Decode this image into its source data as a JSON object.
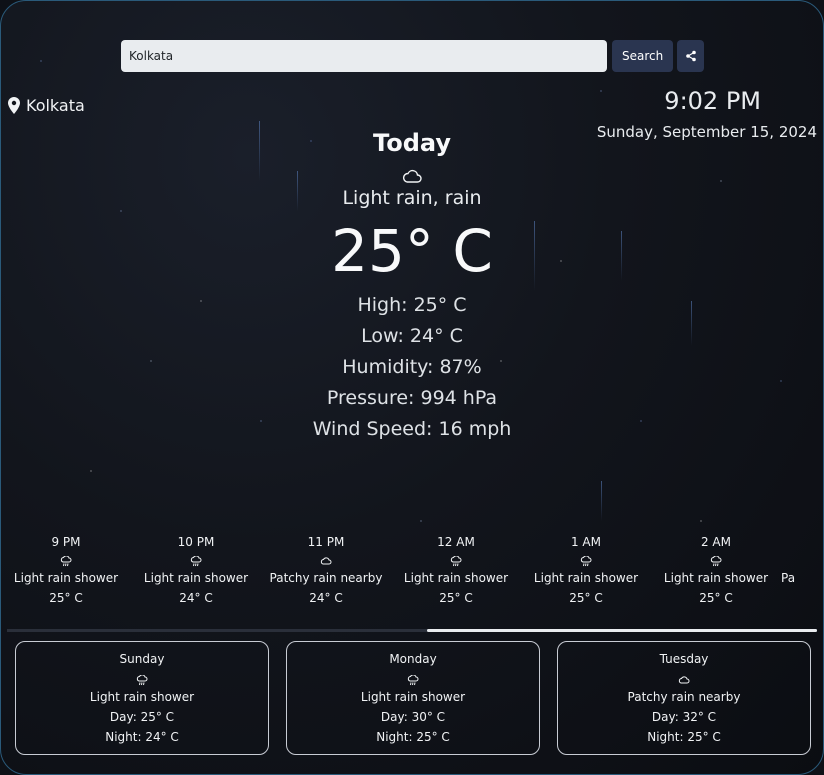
{
  "search": {
    "value": "Kolkata",
    "button_label": "Search"
  },
  "location": {
    "name": "Kolkata"
  },
  "clock": {
    "time": "9:02 PM",
    "date": "Sunday, September 15, 2024"
  },
  "current": {
    "day": "Today",
    "icon": "cloud-icon",
    "condition": "Light rain, rain",
    "temperature": "25° C",
    "high": "High: 25° C",
    "low": "Low: 24° C",
    "humidity": "Humidity: 87%",
    "pressure": "Pressure: 994 hPa",
    "wind": "Wind Speed: 16 mph"
  },
  "hourly": [
    {
      "time": "9 PM",
      "icon": "rain-cloud-icon",
      "condition": "Light rain shower",
      "temp": "25° C"
    },
    {
      "time": "10 PM",
      "icon": "rain-cloud-icon",
      "condition": "Light rain shower",
      "temp": "24° C"
    },
    {
      "time": "11 PM",
      "icon": "cloud-icon",
      "condition": "Patchy rain nearby",
      "temp": "24° C"
    },
    {
      "time": "12 AM",
      "icon": "rain-cloud-icon",
      "condition": "Light rain shower",
      "temp": "25° C"
    },
    {
      "time": "1 AM",
      "icon": "rain-cloud-icon",
      "condition": "Light rain shower",
      "temp": "25° C"
    },
    {
      "time": "2 AM",
      "icon": "rain-cloud-icon",
      "condition": "Light rain shower",
      "temp": "25° C"
    },
    {
      "time": "",
      "icon": "",
      "condition": "Pa",
      "temp": ""
    }
  ],
  "daily": [
    {
      "day": "Sunday",
      "icon": "rain-cloud-icon",
      "condition": "Light rain shower",
      "day_temp": "Day: 25° C",
      "night_temp": "Night: 24° C"
    },
    {
      "day": "Monday",
      "icon": "rain-cloud-icon",
      "condition": "Light rain shower",
      "day_temp": "Day: 30° C",
      "night_temp": "Night: 25° C"
    },
    {
      "day": "Tuesday",
      "icon": "cloud-icon",
      "condition": "Patchy rain nearby",
      "day_temp": "Day: 32° C",
      "night_temp": "Night: 25° C"
    }
  ],
  "colors": {
    "button_bg": "#2a3550",
    "input_bg": "#e9ecef",
    "card_border": "#c8ccd4",
    "text": "#e9ecef"
  }
}
